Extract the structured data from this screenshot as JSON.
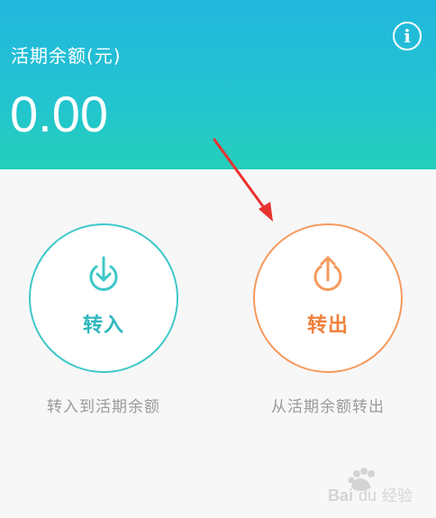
{
  "header": {
    "label": "活期余额(元)",
    "balance": "0.00",
    "info_icon": "info-circle-icon",
    "gradient": [
      "#21b7df",
      "#24cfba"
    ]
  },
  "actions": {
    "transfer_in": {
      "label": "转入",
      "caption": "转入到活期余额",
      "icon": "download-circle-icon",
      "color": "#2fb7bd"
    },
    "transfer_out": {
      "label": "转出",
      "caption": "从活期余额转出",
      "icon": "upload-circle-icon",
      "color": "#f07f3a"
    }
  },
  "annotation": {
    "type": "red-arrow-pointing-to-transfer-out",
    "color": "#e8322f"
  },
  "watermark": {
    "text": "Baidu 经验"
  }
}
